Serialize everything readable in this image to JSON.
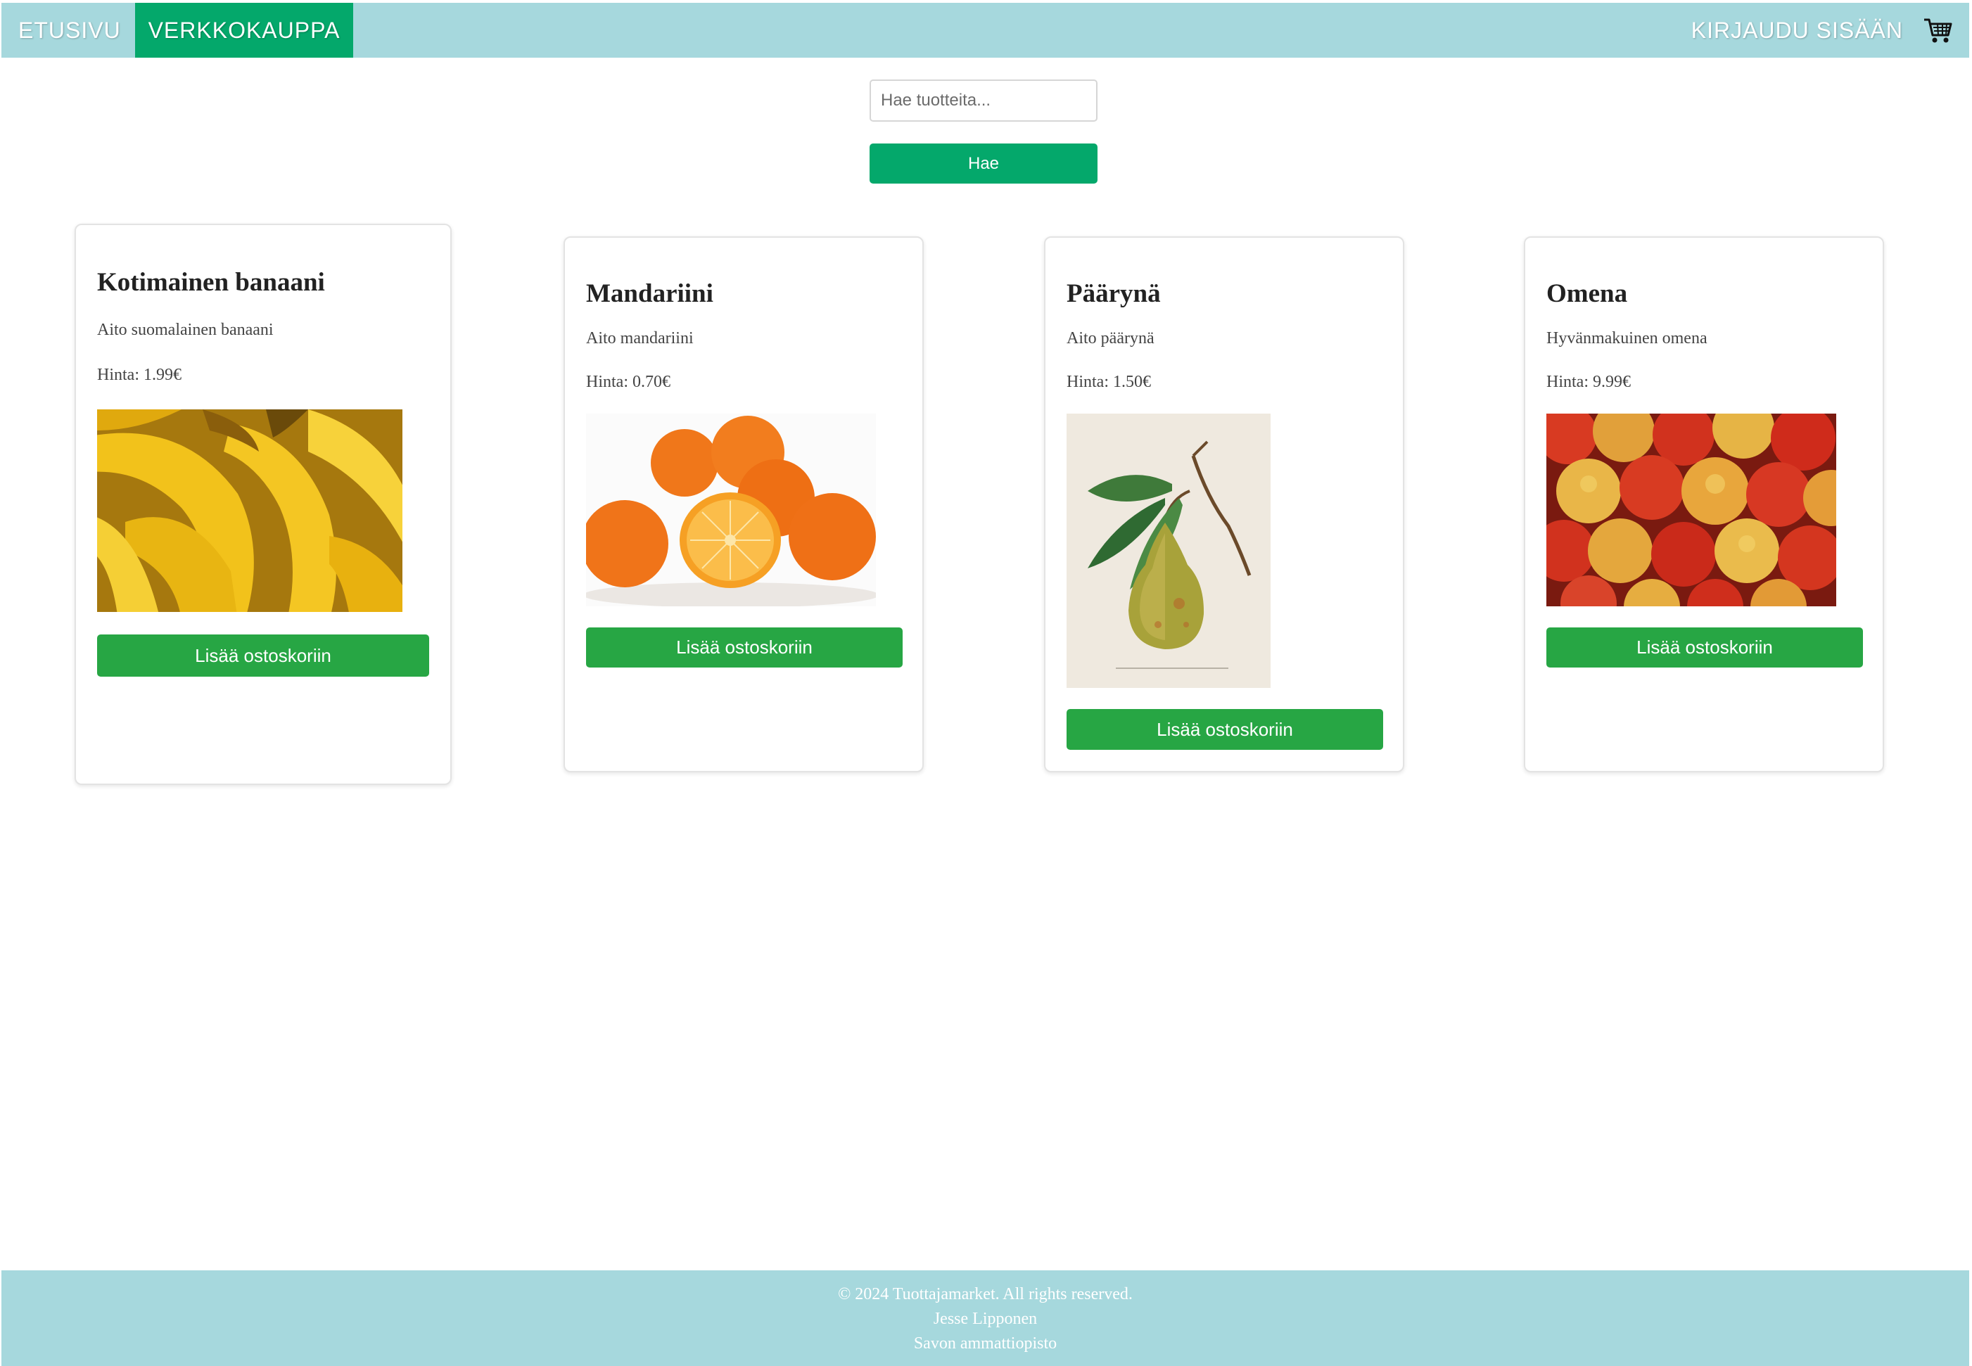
{
  "nav": {
    "home_label": "ETUSIVU",
    "shop_label": "VERKKOKAUPPA",
    "login_label": "KIRJAUDU SISÄÄN",
    "cart_icon": "shopping-cart-icon"
  },
  "search": {
    "placeholder": "Hae tuotteita...",
    "value": "",
    "button_label": "Hae"
  },
  "products": [
    {
      "title": "Kotimainen banaani",
      "description": "Aito suomalainen banaani",
      "price": "Hinta: 1.99€",
      "image": "bananas",
      "button_label": "Lisää ostoskoriin"
    },
    {
      "title": "Mandariini",
      "description": "Aito mandariini",
      "price": "Hinta: 0.70€",
      "image": "oranges",
      "button_label": "Lisää ostoskoriin"
    },
    {
      "title": "Päärynä",
      "description": "Aito päärynä",
      "price": "Hinta: 1.50€",
      "image": "pear-illustration",
      "button_label": "Lisää ostoskoriin"
    },
    {
      "title": "Omena",
      "description": "Hyvänmakuinen omena",
      "price": "Hinta: 9.99€",
      "image": "apples",
      "button_label": "Lisää ostoskoriin"
    }
  ],
  "footer": {
    "copyright": "© 2024 Tuottajamarket. All rights reserved.",
    "author": "Jesse Lipponen",
    "school": "Savon ammattiopisto"
  },
  "colors": {
    "nav_bg": "#a6d8dd",
    "nav_active": "#04a86b",
    "search_button": "#04a86b",
    "add_button": "#27a644"
  }
}
